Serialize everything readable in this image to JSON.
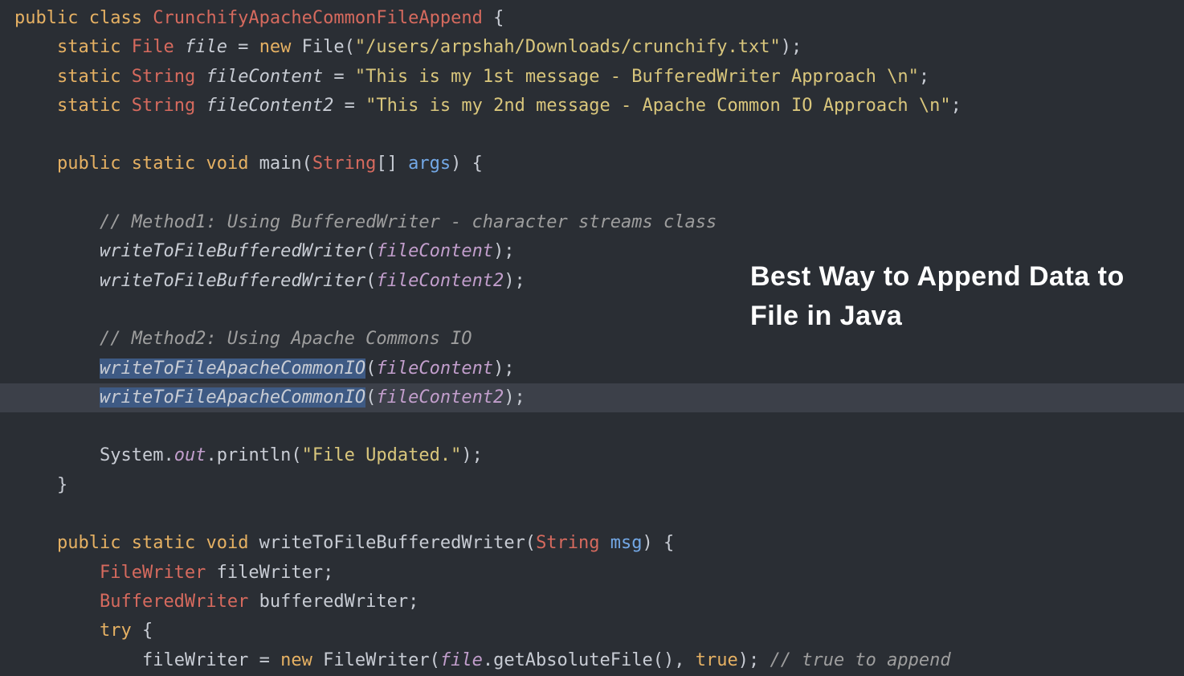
{
  "code": {
    "l1": {
      "kw_public": "public",
      "kw_class": "class",
      "classname": "CrunchifyApacheCommonFileAppend",
      "brace": " {"
    },
    "l2": {
      "kw_static": "static",
      "type": "File",
      "var": "file",
      "eq": " = ",
      "kw_new": "new",
      "ctor": " File(",
      "str": "\"/users/arpshah/Downloads/crunchify.txt\"",
      "end": ");"
    },
    "l3": {
      "kw_static": "static",
      "type": "String",
      "var": "fileContent",
      "eq": " = ",
      "str": "\"This is my 1st message - BufferedWriter Approach \\n\"",
      "end": ";"
    },
    "l4": {
      "kw_static": "static",
      "type": "String",
      "var": "fileContent2",
      "eq": " = ",
      "str": "\"This is my 2nd message - Apache Common IO Approach \\n\"",
      "end": ";"
    },
    "l6": {
      "kw_public": "public",
      "kw_static": "static",
      "kw_void": "void",
      "fn": " main(",
      "type": "String",
      "brackets": "[] ",
      "param": "args",
      "end": ") {"
    },
    "l8": {
      "comment": "// Method1: Using BufferedWriter - character streams class"
    },
    "l9": {
      "fn": "writeToFileBufferedWriter",
      "paren": "(",
      "arg": "fileContent",
      "end": ");"
    },
    "l10": {
      "fn": "writeToFileBufferedWriter",
      "paren": "(",
      "arg": "fileContent2",
      "end": ");"
    },
    "l12": {
      "comment": "// Method2: Using Apache Commons IO"
    },
    "l13": {
      "fn": "writeToFileApacheCommonIO",
      "paren": "(",
      "arg": "fileContent",
      "end": ");"
    },
    "l14": {
      "fn": "writeToFileApacheCommonIO",
      "paren": "(",
      "arg": "fileContent2",
      "end": ");"
    },
    "l16": {
      "sys": "System",
      "dot1": ".",
      "out": "out",
      "dot2": ".",
      "fn": "println(",
      "str": "\"File Updated.\"",
      "end": ");"
    },
    "l17": {
      "brace": "}"
    },
    "l19": {
      "kw_public": "public",
      "kw_static": "static",
      "kw_void": "void",
      "fn": " writeToFileBufferedWriter(",
      "type": "String",
      "param": " msg",
      "end": ") {"
    },
    "l20": {
      "type": "FileWriter",
      "var": " fileWriter;"
    },
    "l21": {
      "type": "BufferedWriter",
      "var": " bufferedWriter;"
    },
    "l22": {
      "kw": "try",
      "brace": " {"
    },
    "l23": {
      "var": "fileWriter = ",
      "kw_new": "new",
      "ctor": " FileWriter(",
      "arg": "file",
      "method": ".getAbsoluteFile(), ",
      "bool": "true",
      "end": "); ",
      "comment": "// true to append"
    }
  },
  "overlay": {
    "text": "Best Way to Append Data to File in Java"
  }
}
